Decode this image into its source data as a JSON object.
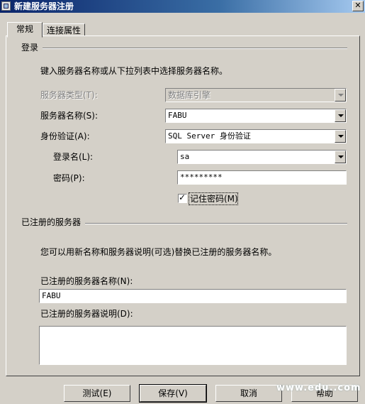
{
  "window": {
    "title": "新建服务器注册"
  },
  "tabs": [
    {
      "label": "常规",
      "active": true
    },
    {
      "label": "连接属性",
      "active": false
    }
  ],
  "login_group": {
    "title": "登录",
    "instruction": "键入服务器名称或从下拉列表中选择服务器名称。",
    "server_type": {
      "label": "服务器类型(T):",
      "value": "数据库引擎",
      "enabled": false
    },
    "server_name": {
      "label": "服务器名称(S):",
      "value": "FABU"
    },
    "authentication": {
      "label": "身份验证(A):",
      "value": "SQL Server 身份验证"
    },
    "login_name": {
      "label": "登录名(L):",
      "value": "sa"
    },
    "password": {
      "label": "密码(P):",
      "value": "*********"
    },
    "remember_password": {
      "label": "记住密码(M)",
      "checked": true
    }
  },
  "registered_group": {
    "title": "已注册的服务器",
    "instruction": "您可以用新名称和服务器说明(可选)替换已注册的服务器名称。",
    "registered_name": {
      "label": "已注册的服务器名称(N):",
      "value": "FABU"
    },
    "registered_description": {
      "label": "已注册的服务器说明(D):",
      "value": ""
    }
  },
  "buttons": {
    "test": "测试(E)",
    "save": "保存(V)",
    "cancel": "取消",
    "help": "帮助"
  },
  "watermark": "www.edu..com"
}
